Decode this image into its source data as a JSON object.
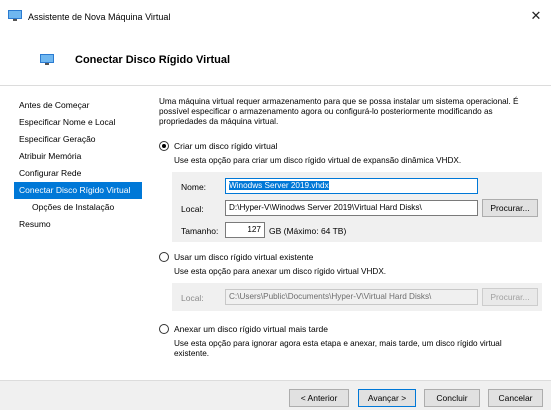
{
  "window": {
    "title": "Assistente de Nova Máquina Virtual",
    "close_symbol": "✕"
  },
  "header": {
    "title": "Conectar Disco Rígido Virtual"
  },
  "sidebar": {
    "items": [
      {
        "label": "Antes de Começar"
      },
      {
        "label": "Especificar Nome e Local"
      },
      {
        "label": "Especificar Geração"
      },
      {
        "label": "Atribuir Memória"
      },
      {
        "label": "Configurar Rede"
      },
      {
        "label": "Conectar Disco Rígido Virtual",
        "selected": true
      },
      {
        "label": "Opções de Instalação",
        "sub": true
      },
      {
        "label": "Resumo"
      }
    ]
  },
  "main": {
    "intro": "Uma máquina virtual requer armazenamento para que se possa instalar um sistema operacional. É possível especificar o armazenamento agora ou configurá-lo posteriormente modificando as propriedades da máquina virtual.",
    "option_create": {
      "label": "Criar um disco rígido virtual",
      "description": "Use esta opção para criar um disco rígido virtual de expansão dinâmica VHDX.",
      "checked": true,
      "name_label": "Nome:",
      "name_value": "Winodws Server 2019.vhdx",
      "location_label": "Local:",
      "location_value": "D:\\Hyper-V\\Winodws Server 2019\\Virtual Hard Disks\\",
      "browse_label": "Procurar...",
      "size_label": "Tamanho:",
      "size_value": "127",
      "size_unit": "GB (Máximo: 64 TB)"
    },
    "option_existing": {
      "label": "Usar um disco rígido virtual existente",
      "description": "Use esta opção para anexar um disco rígido virtual VHDX.",
      "checked": false,
      "location_label": "Local:",
      "location_value": "C:\\Users\\Public\\Documents\\Hyper-V\\Virtual Hard Disks\\",
      "browse_label": "Procurar..."
    },
    "option_later": {
      "label": "Anexar um disco rígido virtual mais tarde",
      "description": "Use esta opção para ignorar agora esta etapa e anexar, mais tarde, um disco rígido virtual existente.",
      "checked": false
    }
  },
  "footer": {
    "back_label": "< Anterior",
    "next_label": "Avançar >",
    "finish_label": "Concluir",
    "cancel_label": "Cancelar"
  },
  "colors": {
    "accent": "#0078d7",
    "panel_bg": "#f0f0f0"
  }
}
